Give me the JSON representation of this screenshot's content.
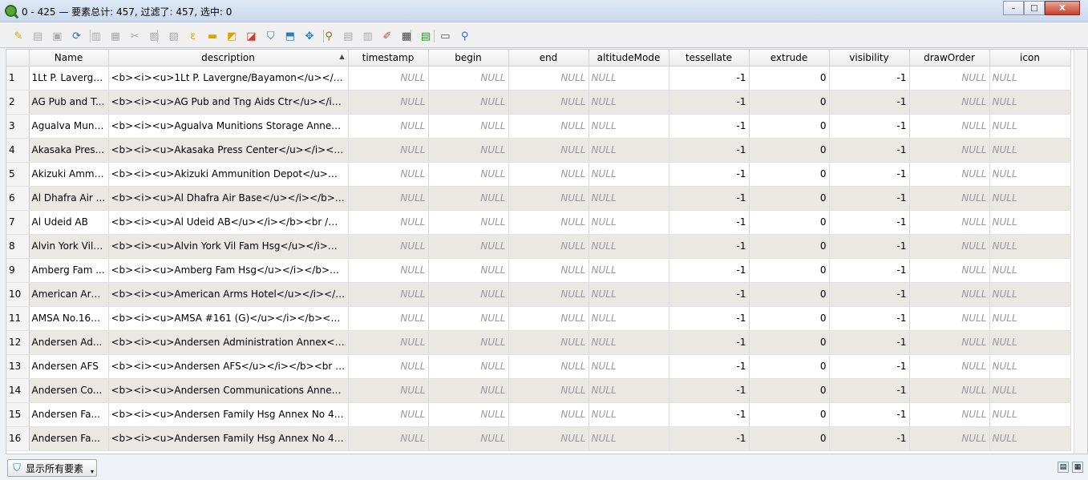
{
  "window": {
    "title": "0 - 425 — 要素总计: 457, 过滤了: 457, 选中: 0",
    "minimize": "–",
    "maximize": "□",
    "close": "X"
  },
  "toolbar": {
    "buttons": [
      {
        "name": "toggle-editing-icon",
        "glyph": "✎",
        "color": "#c9a227"
      },
      {
        "name": "toggle-multi-edit-icon",
        "glyph": "▤",
        "color": "#aaaaaa"
      },
      {
        "name": "save-edits-icon",
        "glyph": "▣",
        "color": "#aaaaaa"
      },
      {
        "name": "reload-icon",
        "glyph": "⟳",
        "color": "#2b6cc4"
      },
      {
        "name": "add-feature-icon",
        "glyph": "▥",
        "color": "#aaaaaa"
      },
      {
        "name": "delete-feature-icon",
        "glyph": "▦",
        "color": "#aaaaaa"
      },
      {
        "name": "cut-icon",
        "glyph": "✂",
        "color": "#aaaaaa"
      },
      {
        "name": "copy-icon",
        "glyph": "▧",
        "color": "#aaaaaa"
      },
      {
        "name": "paste-icon",
        "glyph": "▨",
        "color": "#aaaaaa"
      },
      {
        "name": "select-by-expression-icon",
        "glyph": "ε",
        "color": "#e0a400"
      },
      {
        "name": "select-all-icon",
        "glyph": "▬",
        "color": "#e0a400"
      },
      {
        "name": "invert-selection-icon",
        "glyph": "◩",
        "color": "#e0a400"
      },
      {
        "name": "deselect-all-icon",
        "glyph": "◪",
        "color": "#d23b2b"
      },
      {
        "name": "filter-select-icon",
        "glyph": "⛉",
        "color": "#2c7fb8"
      },
      {
        "name": "move-selection-top-icon",
        "glyph": "⬒",
        "color": "#2c7fb8"
      },
      {
        "name": "pan-to-selection-icon",
        "glyph": "✥",
        "color": "#2c7fb8"
      },
      {
        "name": "zoom-to-selection-icon",
        "glyph": "⚲",
        "color": "#8a6a1a"
      },
      {
        "name": "copy-cells-icon",
        "glyph": "▤",
        "color": "#aaaaaa"
      },
      {
        "name": "paste-features-icon",
        "glyph": "▥",
        "color": "#aaaaaa"
      },
      {
        "name": "new-field-icon",
        "glyph": "✐",
        "color": "#b8405a"
      },
      {
        "name": "field-calculator-icon",
        "glyph": "▦",
        "color": "#444444"
      },
      {
        "name": "conditional-format-icon",
        "glyph": "▤",
        "color": "#3a8a3a"
      },
      {
        "name": "dock-icon",
        "glyph": "▭",
        "color": "#555555"
      },
      {
        "name": "actions-icon",
        "glyph": "⚲",
        "color": "#2b6cc4"
      }
    ]
  },
  "columns": [
    "Name",
    "description",
    "timestamp",
    "begin",
    "end",
    "altitudeMode",
    "tessellate",
    "extrude",
    "visibility",
    "drawOrder",
    "icon"
  ],
  "sorted_column": "description",
  "rows": [
    {
      "id": "1",
      "name": "1Lt P. Lavergn...",
      "description": "<b><i><u>1Lt P. Lavergne/Bayamon</u></i>...",
      "timestamp": "NULL",
      "begin": "NULL",
      "end": "NULL",
      "altitudeMode": "NULL",
      "tessellate": "-1",
      "extrude": "0",
      "visibility": "-1",
      "drawOrder": "NULL",
      "icon": "NULL"
    },
    {
      "id": "2",
      "name": "AG Pub and T...",
      "description": "<b><i><u>AG Pub and Tng Aids Ctr</u></i>...",
      "timestamp": "NULL",
      "begin": "NULL",
      "end": "NULL",
      "altitudeMode": "NULL",
      "tessellate": "-1",
      "extrude": "0",
      "visibility": "-1",
      "drawOrder": "NULL",
      "icon": "NULL"
    },
    {
      "id": "3",
      "name": "Agualva Muni...",
      "description": "<b><i><u>Agualva Munitions Storage Annex<...",
      "timestamp": "NULL",
      "begin": "NULL",
      "end": "NULL",
      "altitudeMode": "NULL",
      "tessellate": "-1",
      "extrude": "0",
      "visibility": "-1",
      "drawOrder": "NULL",
      "icon": "NULL"
    },
    {
      "id": "4",
      "name": "Akasaka Pres...",
      "description": "<b><i><u>Akasaka Press Center</u></i></b...",
      "timestamp": "NULL",
      "begin": "NULL",
      "end": "NULL",
      "altitudeMode": "NULL",
      "tessellate": "-1",
      "extrude": "0",
      "visibility": "-1",
      "drawOrder": "NULL",
      "icon": "NULL"
    },
    {
      "id": "5",
      "name": "Akizuki Ammu...",
      "description": "<b><i><u>Akizuki Ammunition Depot</u></i...",
      "timestamp": "NULL",
      "begin": "NULL",
      "end": "NULL",
      "altitudeMode": "NULL",
      "tessellate": "-1",
      "extrude": "0",
      "visibility": "-1",
      "drawOrder": "NULL",
      "icon": "NULL"
    },
    {
      "id": "6",
      "name": "Al Dhafra Air ...",
      "description": "<b><i><u>Al Dhafra Air Base</u></i></b><...",
      "timestamp": "NULL",
      "begin": "NULL",
      "end": "NULL",
      "altitudeMode": "NULL",
      "tessellate": "-1",
      "extrude": "0",
      "visibility": "-1",
      "drawOrder": "NULL",
      "icon": "NULL"
    },
    {
      "id": "7",
      "name": "Al Udeid AB",
      "description": "<b><i><u>Al Udeid AB</u></i></b><br />C...",
      "timestamp": "NULL",
      "begin": "NULL",
      "end": "NULL",
      "altitudeMode": "NULL",
      "tessellate": "-1",
      "extrude": "0",
      "visibility": "-1",
      "drawOrder": "NULL",
      "icon": "NULL"
    },
    {
      "id": "8",
      "name": "Alvin York Vil ...",
      "description": "<b><i><u>Alvin York Vil Fam Hsg</u></i></b...",
      "timestamp": "NULL",
      "begin": "NULL",
      "end": "NULL",
      "altitudeMode": "NULL",
      "tessellate": "-1",
      "extrude": "0",
      "visibility": "-1",
      "drawOrder": "NULL",
      "icon": "NULL"
    },
    {
      "id": "9",
      "name": "Amberg Fam ...",
      "description": "<b><i><u>Amberg Fam Hsg</u></i></b><b...",
      "timestamp": "NULL",
      "begin": "NULL",
      "end": "NULL",
      "altitudeMode": "NULL",
      "tessellate": "-1",
      "extrude": "0",
      "visibility": "-1",
      "drawOrder": "NULL",
      "icon": "NULL"
    },
    {
      "id": "10",
      "name": "American Arm...",
      "description": "<b><i><u>American Arms Hotel</u></i></b...",
      "timestamp": "NULL",
      "begin": "NULL",
      "end": "NULL",
      "altitudeMode": "NULL",
      "tessellate": "-1",
      "extrude": "0",
      "visibility": "-1",
      "drawOrder": "NULL",
      "icon": "NULL"
    },
    {
      "id": "11",
      "name": "AMSA No.161...",
      "description": "<b><i><u>AMSA #161 (G)</u></i></b><br /...",
      "timestamp": "NULL",
      "begin": "NULL",
      "end": "NULL",
      "altitudeMode": "NULL",
      "tessellate": "-1",
      "extrude": "0",
      "visibility": "-1",
      "drawOrder": "NULL",
      "icon": "NULL"
    },
    {
      "id": "12",
      "name": "Andersen Ad...",
      "description": "<b><i><u>Andersen Administration Annex</u...",
      "timestamp": "NULL",
      "begin": "NULL",
      "end": "NULL",
      "altitudeMode": "NULL",
      "tessellate": "-1",
      "extrude": "0",
      "visibility": "-1",
      "drawOrder": "NULL",
      "icon": "NULL"
    },
    {
      "id": "13",
      "name": "Andersen AFS",
      "description": "<b><i><u>Andersen AFS</u></i></b><br />...",
      "timestamp": "NULL",
      "begin": "NULL",
      "end": "NULL",
      "altitudeMode": "NULL",
      "tessellate": "-1",
      "extrude": "0",
      "visibility": "-1",
      "drawOrder": "NULL",
      "icon": "NULL"
    },
    {
      "id": "14",
      "name": "Andersen Co...",
      "description": "<b><i><u>Andersen Communications Annex N...",
      "timestamp": "NULL",
      "begin": "NULL",
      "end": "NULL",
      "altitudeMode": "NULL",
      "tessellate": "-1",
      "extrude": "0",
      "visibility": "-1",
      "drawOrder": "NULL",
      "icon": "NULL"
    },
    {
      "id": "15",
      "name": "Andersen Fa...",
      "description": "<b><i><u>Andersen Family Hsg Annex No 4</...",
      "timestamp": "NULL",
      "begin": "NULL",
      "end": "NULL",
      "altitudeMode": "NULL",
      "tessellate": "-1",
      "extrude": "0",
      "visibility": "-1",
      "drawOrder": "NULL",
      "icon": "NULL"
    },
    {
      "id": "16",
      "name": "Andersen Fa...",
      "description": "<b><i><u>Andersen Family Hsg Annex No 4</...",
      "timestamp": "NULL",
      "begin": "NULL",
      "end": "NULL",
      "altitudeMode": "NULL",
      "tessellate": "-1",
      "extrude": "0",
      "visibility": "-1",
      "drawOrder": "NULL",
      "icon": "NULL"
    }
  ],
  "footer": {
    "filter_label": "显示所有要素",
    "filter_icon": "filter-icon"
  },
  "colors": {
    "alt_row": "#e9e8e3",
    "null_text": "#9a9a9a"
  }
}
